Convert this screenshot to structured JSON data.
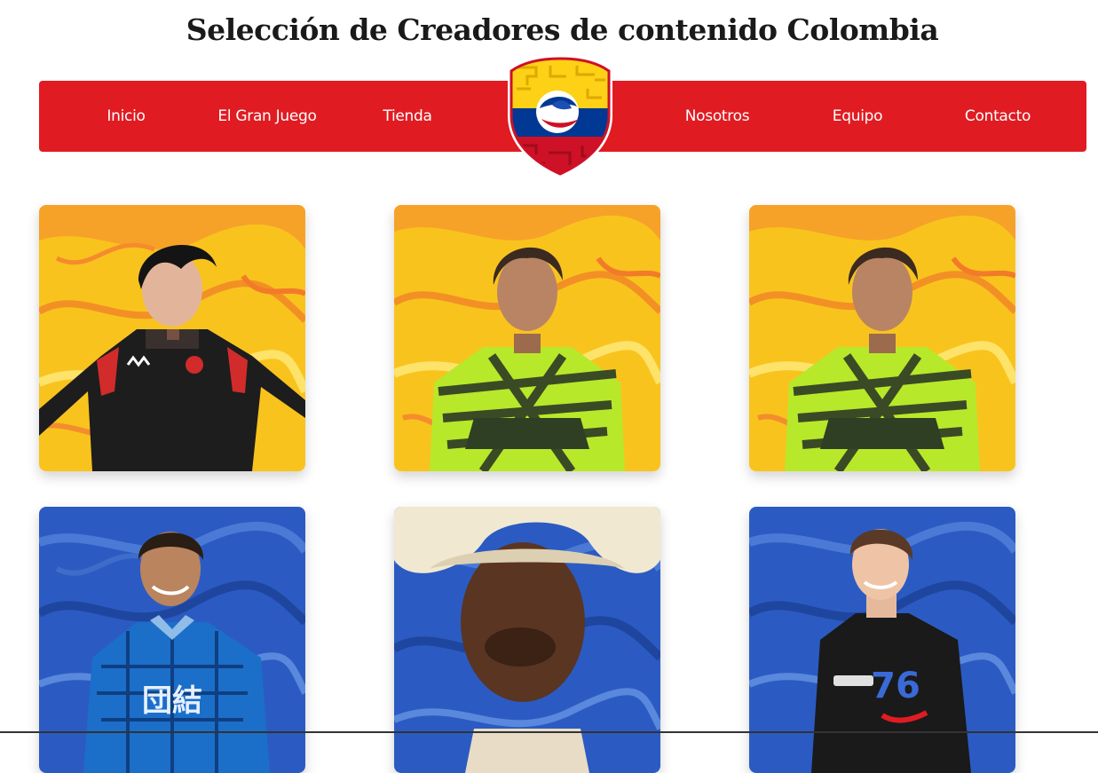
{
  "page": {
    "title": "Selección de Creadores de contenido Colombia"
  },
  "nav": {
    "items": [
      {
        "label": "Inicio"
      },
      {
        "label": "El Gran Juego"
      },
      {
        "label": "Tienda"
      },
      {
        "label": "Nosotros"
      },
      {
        "label": "Equipo"
      },
      {
        "label": "Contacto"
      }
    ],
    "logo_icon": "colombia-shield-crest-icon"
  },
  "creators": [
    {
      "background": "yellow-marble",
      "jersey": "black-red"
    },
    {
      "background": "yellow-marble",
      "jersey": "neon-green-striped"
    },
    {
      "background": "yellow-marble",
      "jersey": "neon-green-striped"
    },
    {
      "background": "blue-marble",
      "jersey": "blue-patterned"
    },
    {
      "background": "blue-marble",
      "jersey": "straw-hat"
    },
    {
      "background": "blue-marble",
      "jersey": "black-tee"
    }
  ],
  "colors": {
    "nav_red": "#e01c22",
    "flag_yellow": "#fcd116",
    "flag_blue": "#003893",
    "flag_red": "#ce1126",
    "card_yellow": "#f9c31e",
    "card_blue": "#2b5bc2"
  }
}
